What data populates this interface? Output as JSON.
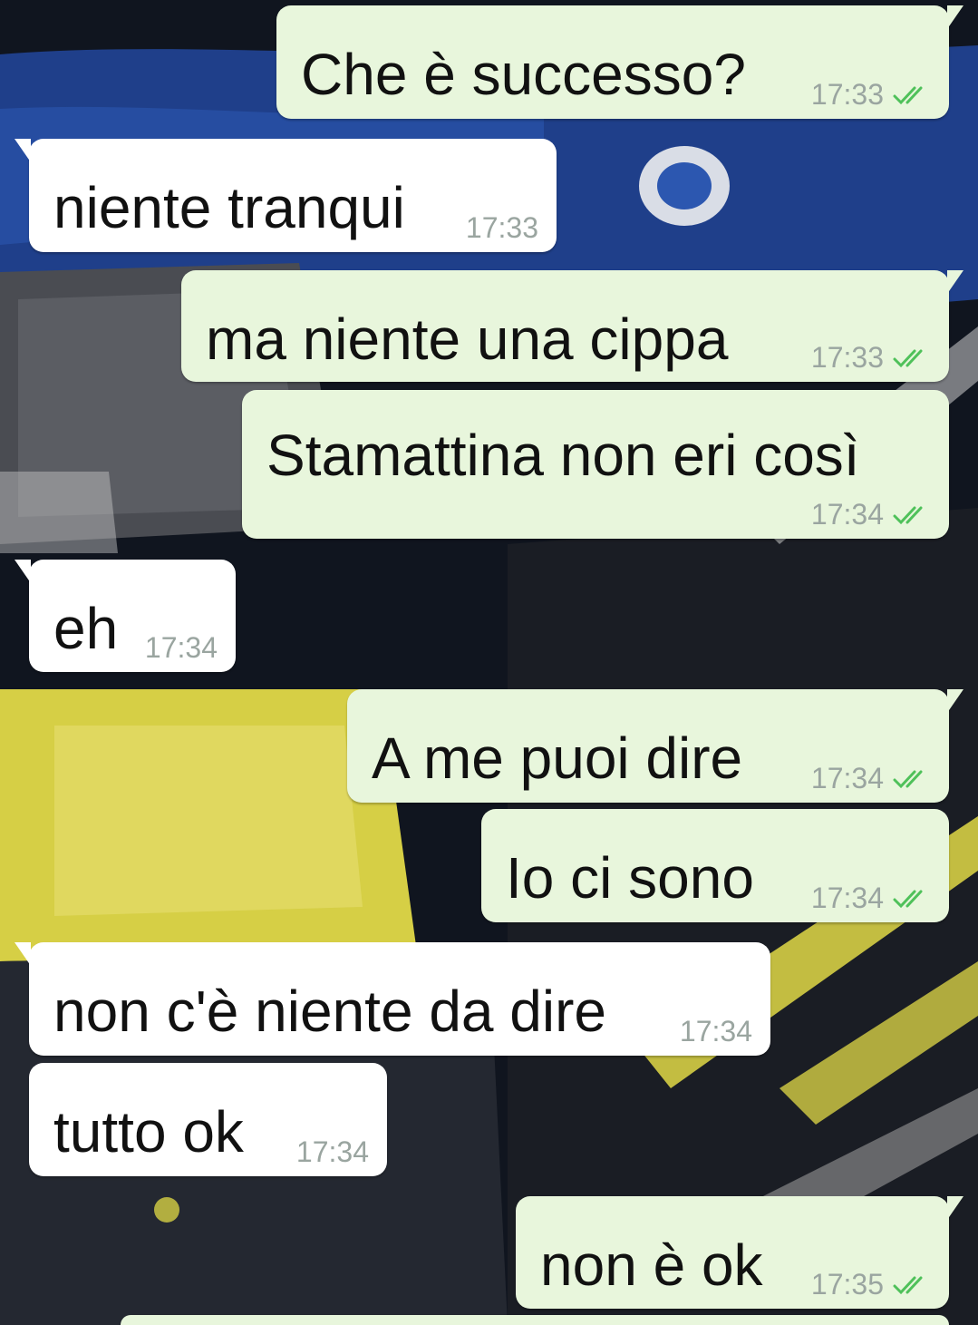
{
  "chat": {
    "messages": [
      {
        "direction": "out",
        "text": "Che è successo?",
        "time": "17:33",
        "status": "read"
      },
      {
        "direction": "in",
        "text": "niente tranqui",
        "time": "17:33"
      },
      {
        "direction": "out",
        "text": "ma niente una cippa",
        "time": "17:33",
        "status": "read"
      },
      {
        "direction": "out",
        "text": "Stamattina non eri così",
        "time": "17:34",
        "status": "read"
      },
      {
        "direction": "in",
        "text": "eh",
        "time": "17:34"
      },
      {
        "direction": "out",
        "text": "A me puoi dire",
        "time": "17:34",
        "status": "read"
      },
      {
        "direction": "out",
        "text": "Io ci sono",
        "time": "17:34",
        "status": "read"
      },
      {
        "direction": "in",
        "text": "non c'è niente da dire",
        "time": "17:34"
      },
      {
        "direction": "in",
        "text": "tutto ok",
        "time": "17:34"
      },
      {
        "direction": "out",
        "text": "non è ok",
        "time": "17:35",
        "status": "read"
      }
    ]
  },
  "colors": {
    "outgoing_bubble": "#e8f6dc",
    "incoming_bubble": "#ffffff",
    "read_tick": "#4fc15a",
    "timestamp": "#9aa5a0",
    "wallpaper_accent": "#d8d24a",
    "wallpaper_blue": "#1f3f8a"
  },
  "icons": {
    "read_receipt": "double-check-icon",
    "wallpaper": "motorcycle-wallpaper"
  }
}
